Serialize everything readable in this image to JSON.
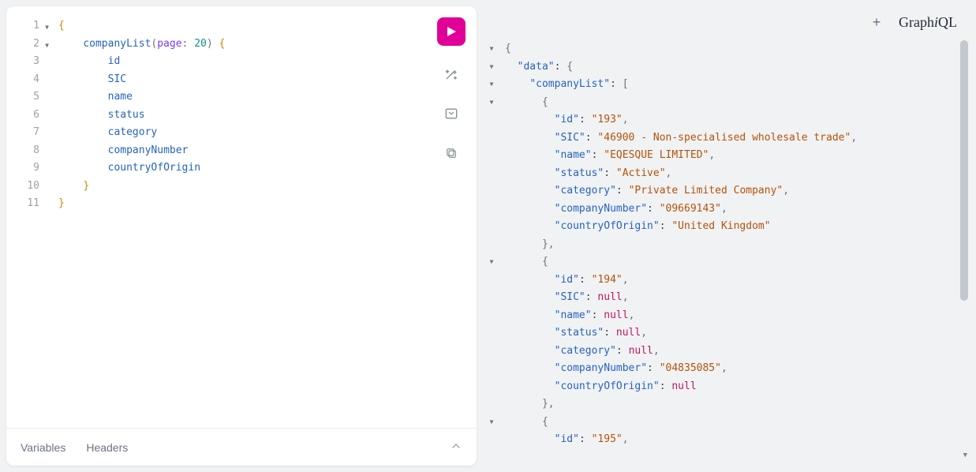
{
  "logo": {
    "graph": "Graph",
    "i": "i",
    "ql": "QL"
  },
  "query": {
    "lines": [
      {
        "n": 1,
        "fold": true,
        "tokens": [
          [
            "brace",
            "{"
          ]
        ]
      },
      {
        "n": 2,
        "fold": true,
        "tokens": [
          [
            "ind",
            "    "
          ],
          [
            "prop",
            "companyList"
          ],
          [
            "par",
            "("
          ],
          [
            "attr",
            "page"
          ],
          [
            "punc",
            ": "
          ],
          [
            "num",
            "20"
          ],
          [
            "par",
            ")"
          ],
          [
            "punc",
            " "
          ],
          [
            "brace",
            "{"
          ]
        ]
      },
      {
        "n": 3,
        "fold": false,
        "tokens": [
          [
            "ind",
            "        "
          ],
          [
            "prop",
            "id"
          ]
        ]
      },
      {
        "n": 4,
        "fold": false,
        "tokens": [
          [
            "ind",
            "        "
          ],
          [
            "prop",
            "SIC"
          ]
        ]
      },
      {
        "n": 5,
        "fold": false,
        "tokens": [
          [
            "ind",
            "        "
          ],
          [
            "prop",
            "name"
          ]
        ]
      },
      {
        "n": 6,
        "fold": false,
        "tokens": [
          [
            "ind",
            "        "
          ],
          [
            "prop",
            "status"
          ]
        ]
      },
      {
        "n": 7,
        "fold": false,
        "tokens": [
          [
            "ind",
            "        "
          ],
          [
            "prop",
            "category"
          ]
        ]
      },
      {
        "n": 8,
        "fold": false,
        "tokens": [
          [
            "ind",
            "        "
          ],
          [
            "prop",
            "companyNumber"
          ]
        ]
      },
      {
        "n": 9,
        "fold": false,
        "tokens": [
          [
            "ind",
            "        "
          ],
          [
            "prop",
            "countryOfOrigin"
          ]
        ]
      },
      {
        "n": 10,
        "fold": false,
        "tokens": [
          [
            "ind",
            "    "
          ],
          [
            "brace",
            "}"
          ]
        ]
      },
      {
        "n": 11,
        "fold": false,
        "tokens": [
          [
            "brace",
            "}"
          ]
        ]
      }
    ]
  },
  "result": {
    "lines": [
      {
        "fold": true,
        "tokens": [
          [
            "punc",
            "{"
          ]
        ]
      },
      {
        "fold": true,
        "tokens": [
          [
            "ind",
            "  "
          ],
          [
            "key",
            "\"data\""
          ],
          [
            "col",
            ": "
          ],
          [
            "punc",
            "{"
          ]
        ]
      },
      {
        "fold": true,
        "tokens": [
          [
            "ind",
            "    "
          ],
          [
            "key",
            "\"companyList\""
          ],
          [
            "col",
            ": "
          ],
          [
            "punc",
            "["
          ]
        ]
      },
      {
        "fold": true,
        "tokens": [
          [
            "ind",
            "      "
          ],
          [
            "punc",
            "{"
          ]
        ]
      },
      {
        "fold": false,
        "tokens": [
          [
            "ind",
            "        "
          ],
          [
            "key",
            "\"id\""
          ],
          [
            "col",
            ": "
          ],
          [
            "str",
            "\"193\""
          ],
          [
            "punc",
            ","
          ]
        ]
      },
      {
        "fold": false,
        "tokens": [
          [
            "ind",
            "        "
          ],
          [
            "key",
            "\"SIC\""
          ],
          [
            "col",
            ": "
          ],
          [
            "str",
            "\"46900 - Non-specialised wholesale trade\""
          ],
          [
            "punc",
            ","
          ]
        ]
      },
      {
        "fold": false,
        "tokens": [
          [
            "ind",
            "        "
          ],
          [
            "key",
            "\"name\""
          ],
          [
            "col",
            ": "
          ],
          [
            "str",
            "\"EQESQUE LIMITED\""
          ],
          [
            "punc",
            ","
          ]
        ]
      },
      {
        "fold": false,
        "tokens": [
          [
            "ind",
            "        "
          ],
          [
            "key",
            "\"status\""
          ],
          [
            "col",
            ": "
          ],
          [
            "str",
            "\"Active\""
          ],
          [
            "punc",
            ","
          ]
        ]
      },
      {
        "fold": false,
        "tokens": [
          [
            "ind",
            "        "
          ],
          [
            "key",
            "\"category\""
          ],
          [
            "col",
            ": "
          ],
          [
            "str",
            "\"Private Limited Company\""
          ],
          [
            "punc",
            ","
          ]
        ]
      },
      {
        "fold": false,
        "tokens": [
          [
            "ind",
            "        "
          ],
          [
            "key",
            "\"companyNumber\""
          ],
          [
            "col",
            ": "
          ],
          [
            "str",
            "\"09669143\""
          ],
          [
            "punc",
            ","
          ]
        ]
      },
      {
        "fold": false,
        "tokens": [
          [
            "ind",
            "        "
          ],
          [
            "key",
            "\"countryOfOrigin\""
          ],
          [
            "col",
            ": "
          ],
          [
            "str",
            "\"United Kingdom\""
          ]
        ]
      },
      {
        "fold": false,
        "tokens": [
          [
            "ind",
            "      "
          ],
          [
            "punc",
            "},"
          ]
        ]
      },
      {
        "fold": true,
        "tokens": [
          [
            "ind",
            "      "
          ],
          [
            "punc",
            "{"
          ]
        ]
      },
      {
        "fold": false,
        "tokens": [
          [
            "ind",
            "        "
          ],
          [
            "key",
            "\"id\""
          ],
          [
            "col",
            ": "
          ],
          [
            "str",
            "\"194\""
          ],
          [
            "punc",
            ","
          ]
        ]
      },
      {
        "fold": false,
        "tokens": [
          [
            "ind",
            "        "
          ],
          [
            "key",
            "\"SIC\""
          ],
          [
            "col",
            ": "
          ],
          [
            "null",
            "null"
          ],
          [
            "punc",
            ","
          ]
        ]
      },
      {
        "fold": false,
        "tokens": [
          [
            "ind",
            "        "
          ],
          [
            "key",
            "\"name\""
          ],
          [
            "col",
            ": "
          ],
          [
            "null",
            "null"
          ],
          [
            "punc",
            ","
          ]
        ]
      },
      {
        "fold": false,
        "tokens": [
          [
            "ind",
            "        "
          ],
          [
            "key",
            "\"status\""
          ],
          [
            "col",
            ": "
          ],
          [
            "null",
            "null"
          ],
          [
            "punc",
            ","
          ]
        ]
      },
      {
        "fold": false,
        "tokens": [
          [
            "ind",
            "        "
          ],
          [
            "key",
            "\"category\""
          ],
          [
            "col",
            ": "
          ],
          [
            "null",
            "null"
          ],
          [
            "punc",
            ","
          ]
        ]
      },
      {
        "fold": false,
        "tokens": [
          [
            "ind",
            "        "
          ],
          [
            "key",
            "\"companyNumber\""
          ],
          [
            "col",
            ": "
          ],
          [
            "str",
            "\"04835085\""
          ],
          [
            "punc",
            ","
          ]
        ]
      },
      {
        "fold": false,
        "tokens": [
          [
            "ind",
            "        "
          ],
          [
            "key",
            "\"countryOfOrigin\""
          ],
          [
            "col",
            ": "
          ],
          [
            "null",
            "null"
          ]
        ]
      },
      {
        "fold": false,
        "tokens": [
          [
            "ind",
            "      "
          ],
          [
            "punc",
            "},"
          ]
        ]
      },
      {
        "fold": true,
        "tokens": [
          [
            "ind",
            "      "
          ],
          [
            "punc",
            "{"
          ]
        ]
      },
      {
        "fold": false,
        "tokens": [
          [
            "ind",
            "        "
          ],
          [
            "key",
            "\"id\""
          ],
          [
            "col",
            ": "
          ],
          [
            "str",
            "\"195\""
          ],
          [
            "punc",
            ","
          ]
        ]
      }
    ]
  },
  "footer": {
    "variables": "Variables",
    "headers": "Headers"
  }
}
